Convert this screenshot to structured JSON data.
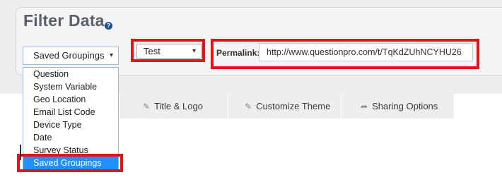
{
  "filter": {
    "title": "Filter Data",
    "help_icon": "question-circle-icon",
    "grouping_select": {
      "value": "Saved Groupings",
      "caret": "▾"
    },
    "test_select": {
      "value": "Test",
      "caret": "▾"
    },
    "permalink": {
      "label": "Permalink:",
      "value": "http://www.questionpro.com/t/TqKdZUhNCYHU26"
    }
  },
  "dropdown": {
    "options": [
      "Question",
      "System Variable",
      "Geo Location",
      "Email List Code",
      "Device Type",
      "Date",
      "Survey Status",
      "Saved Groupings"
    ],
    "selected_index": 7
  },
  "tabs": [
    {
      "label": "Title & Logo",
      "icon": "edit-icon"
    },
    {
      "label": "Customize Theme",
      "icon": "edit-icon"
    },
    {
      "label": "Sharing Options",
      "icon": "share-arrow-icon"
    }
  ],
  "colors": {
    "highlight": "#e3121b",
    "selected_option": "#1e90ff",
    "help_icon": "#1b4f97"
  }
}
